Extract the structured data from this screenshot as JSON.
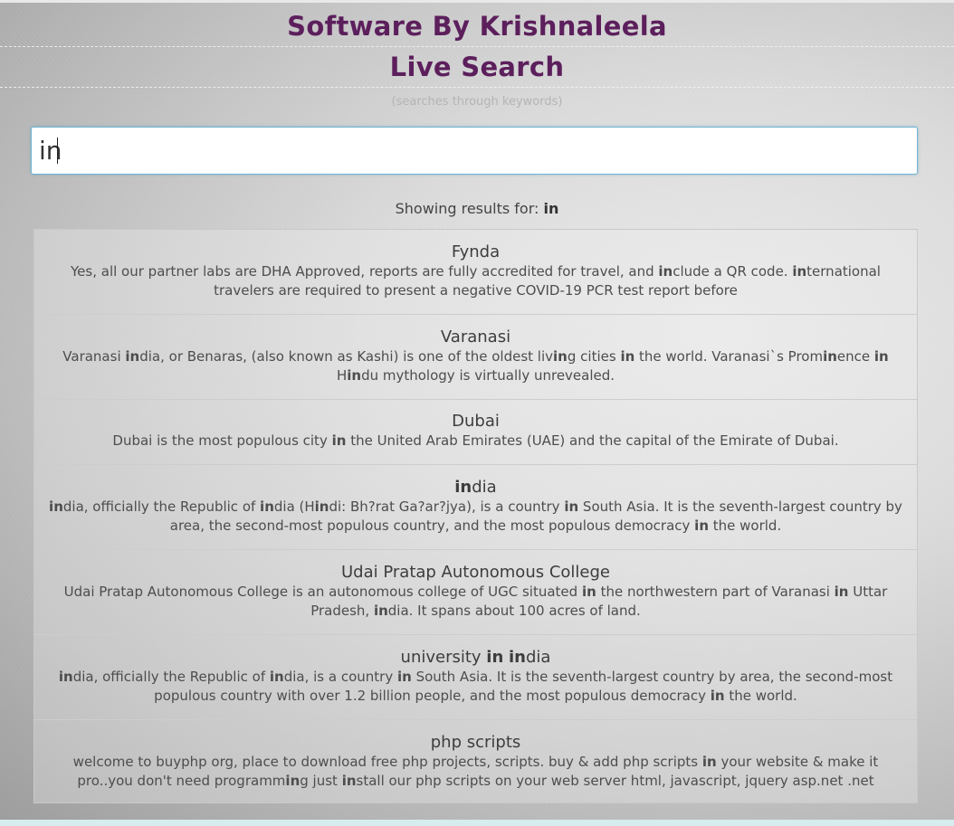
{
  "header": {
    "brand": "Software By Krishnaleela",
    "title": "Live Search",
    "subtitle": "(searches through keywords)"
  },
  "search": {
    "value": "in",
    "placeholder": ""
  },
  "results_header": {
    "label": "Showing results for:",
    "query": "in"
  },
  "results": [
    {
      "title": "Fynda",
      "description": "Yes, all our partner labs are DHA Approved, reports are fully accredited for travel, and include a QR code. international travelers are required to present a negative COVID-19 PCR test report before"
    },
    {
      "title": "Varanasi",
      "description": "Varanasi india, or Benaras, (also known as Kashi) is one of the oldest living cities in the world. Varanasi`s Prominence in Hindu mythology is virtually unrevealed."
    },
    {
      "title": "Dubai",
      "description": "Dubai is the most populous city in the United Arab Emirates (UAE) and the capital of the Emirate of Dubai."
    },
    {
      "title": "india",
      "description": "india, officially the Republic of india (Hindi: Bh?rat Ga?ar?jya), is a country in South Asia. It is the seventh-largest country by area, the second-most populous country, and the most populous democracy in the world."
    },
    {
      "title": "Udai Pratap Autonomous College",
      "description": "Udai Pratap Autonomous College is an autonomous college of UGC situated in the northwestern part of Varanasi in Uttar Pradesh, india. It spans about 100 acres of land."
    },
    {
      "title": "university in india",
      "description": "india, officially the Republic of india, is a country in South Asia. It is the seventh-largest country by area, the second-most populous country with over 1.2 billion people, and the most populous democracy in the world."
    },
    {
      "title": "php scripts",
      "description": "welcome to buyphp org, place to download free php projects, scripts. buy & add php scripts in your website & make it pro..you don't need programming just install our php scripts on your web server html, javascript, jquery asp.net .net"
    }
  ]
}
